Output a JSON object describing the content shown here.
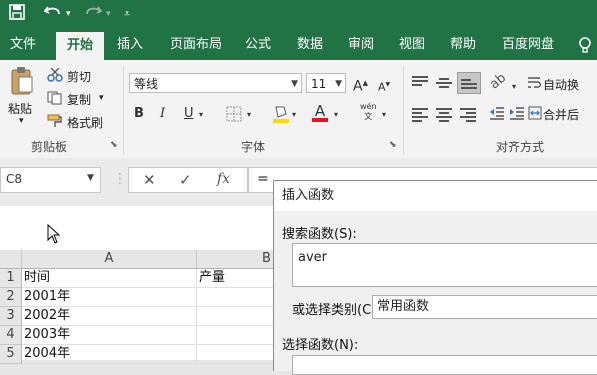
{
  "tabs": [
    "文件",
    "开始",
    "插入",
    "页面布局",
    "公式",
    "数据",
    "审阅",
    "视图",
    "帮助",
    "百度网盘"
  ],
  "clipboard": {
    "paste_label": "粘贴",
    "cut_label": "剪切",
    "copy_label": "复制",
    "format_painter_label": "格式刷",
    "group_label": "剪贴板"
  },
  "font": {
    "font_name": "等线",
    "font_size": "11",
    "grow_label": "A",
    "shrink_label": "A",
    "bold_label": "B",
    "italic_label": "I",
    "underline_label": "U",
    "font_color_label": "A",
    "phonetic_label": "wén",
    "group_label": "字体"
  },
  "alignment": {
    "wrap_text_label": "自动换",
    "merge_label": "合并后",
    "group_label": "对齐方式"
  },
  "formula_bar": {
    "name_box": "C8",
    "cancel": "✕",
    "enter": "✓",
    "fx": "fx",
    "formula": "="
  },
  "sheet": {
    "columns": [
      "A",
      "B"
    ],
    "rows": [
      {
        "num": "1",
        "a": "时间",
        "b": "产量"
      },
      {
        "num": "2",
        "a": "2001年",
        "b": ""
      },
      {
        "num": "3",
        "a": "2002年",
        "b": ""
      },
      {
        "num": "4",
        "a": "2003年",
        "b": ""
      },
      {
        "num": "5",
        "a": "2004年",
        "b": ""
      }
    ]
  },
  "dialog": {
    "title": "插入函数",
    "search_label": "搜索函数(S):",
    "search_value": "aver",
    "category_label": "或选择类别(C):",
    "category_value": "常用函数",
    "select_label": "选择函数(N):"
  }
}
